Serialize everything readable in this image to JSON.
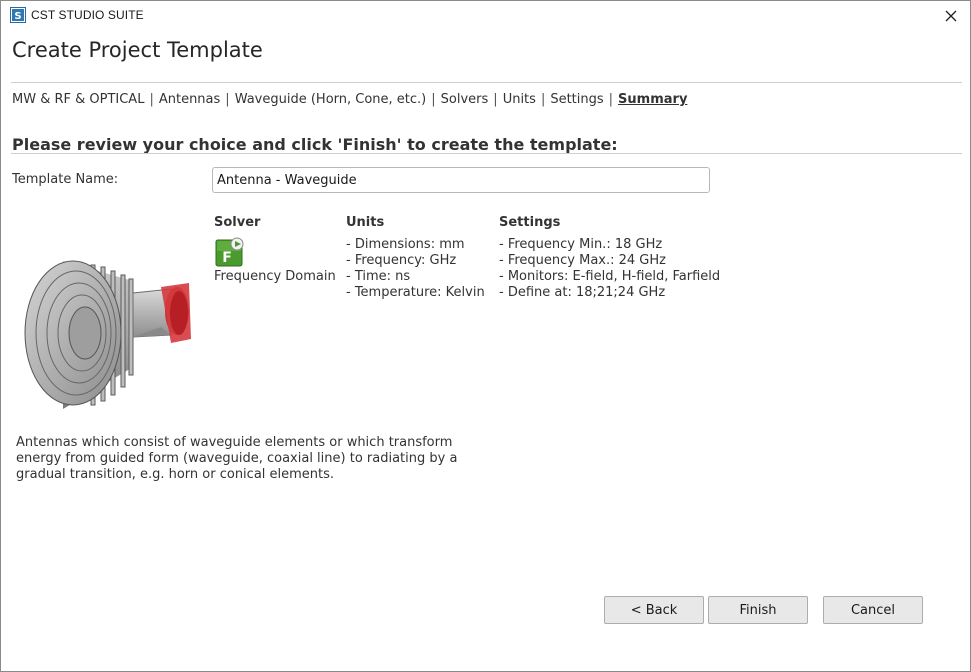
{
  "app": {
    "window_title": "CST STUDIO SUITE",
    "icon": "cst-logo-icon",
    "close_icon": "close-icon"
  },
  "page": {
    "title": "Create Project Template"
  },
  "breadcrumb": {
    "items": [
      "MW & RF & OPTICAL",
      "Antennas",
      "Waveguide (Horn, Cone, etc.)",
      "Solvers",
      "Units",
      "Settings"
    ],
    "separator": "|",
    "current": "Summary"
  },
  "review": {
    "heading": "Please review your choice and click 'Finish' to create the template:"
  },
  "template_name": {
    "label": "Template Name:",
    "value": "Antenna - Waveguide"
  },
  "summary": {
    "solver": {
      "header": "Solver",
      "icon": "frequency-domain-solver-icon",
      "icon_letter": "F",
      "name": "Frequency Domain"
    },
    "units": {
      "header": "Units",
      "items": [
        "- Dimensions: mm",
        "- Frequency: GHz",
        "- Time: ns",
        "- Temperature: Kelvin"
      ]
    },
    "settings": {
      "header": "Settings",
      "items": [
        "- Frequency Min.: 18 GHz",
        "- Frequency Max.: 24 GHz",
        "- Monitors: E-field, H-field, Farfield",
        "- Define at: 18;21;24 GHz"
      ]
    }
  },
  "description": "Antennas which consist of waveguide elements or which transform energy from guided form (waveguide, coaxial line) to radiating by a gradual transition, e.g. horn or conical elements.",
  "buttons": {
    "back": "< Back",
    "finish": "Finish",
    "cancel": "Cancel"
  },
  "colors": {
    "solver_icon_green": "#4a9a2e",
    "horn_grey": "#9a9a9a",
    "port_red": "#c8282d"
  }
}
